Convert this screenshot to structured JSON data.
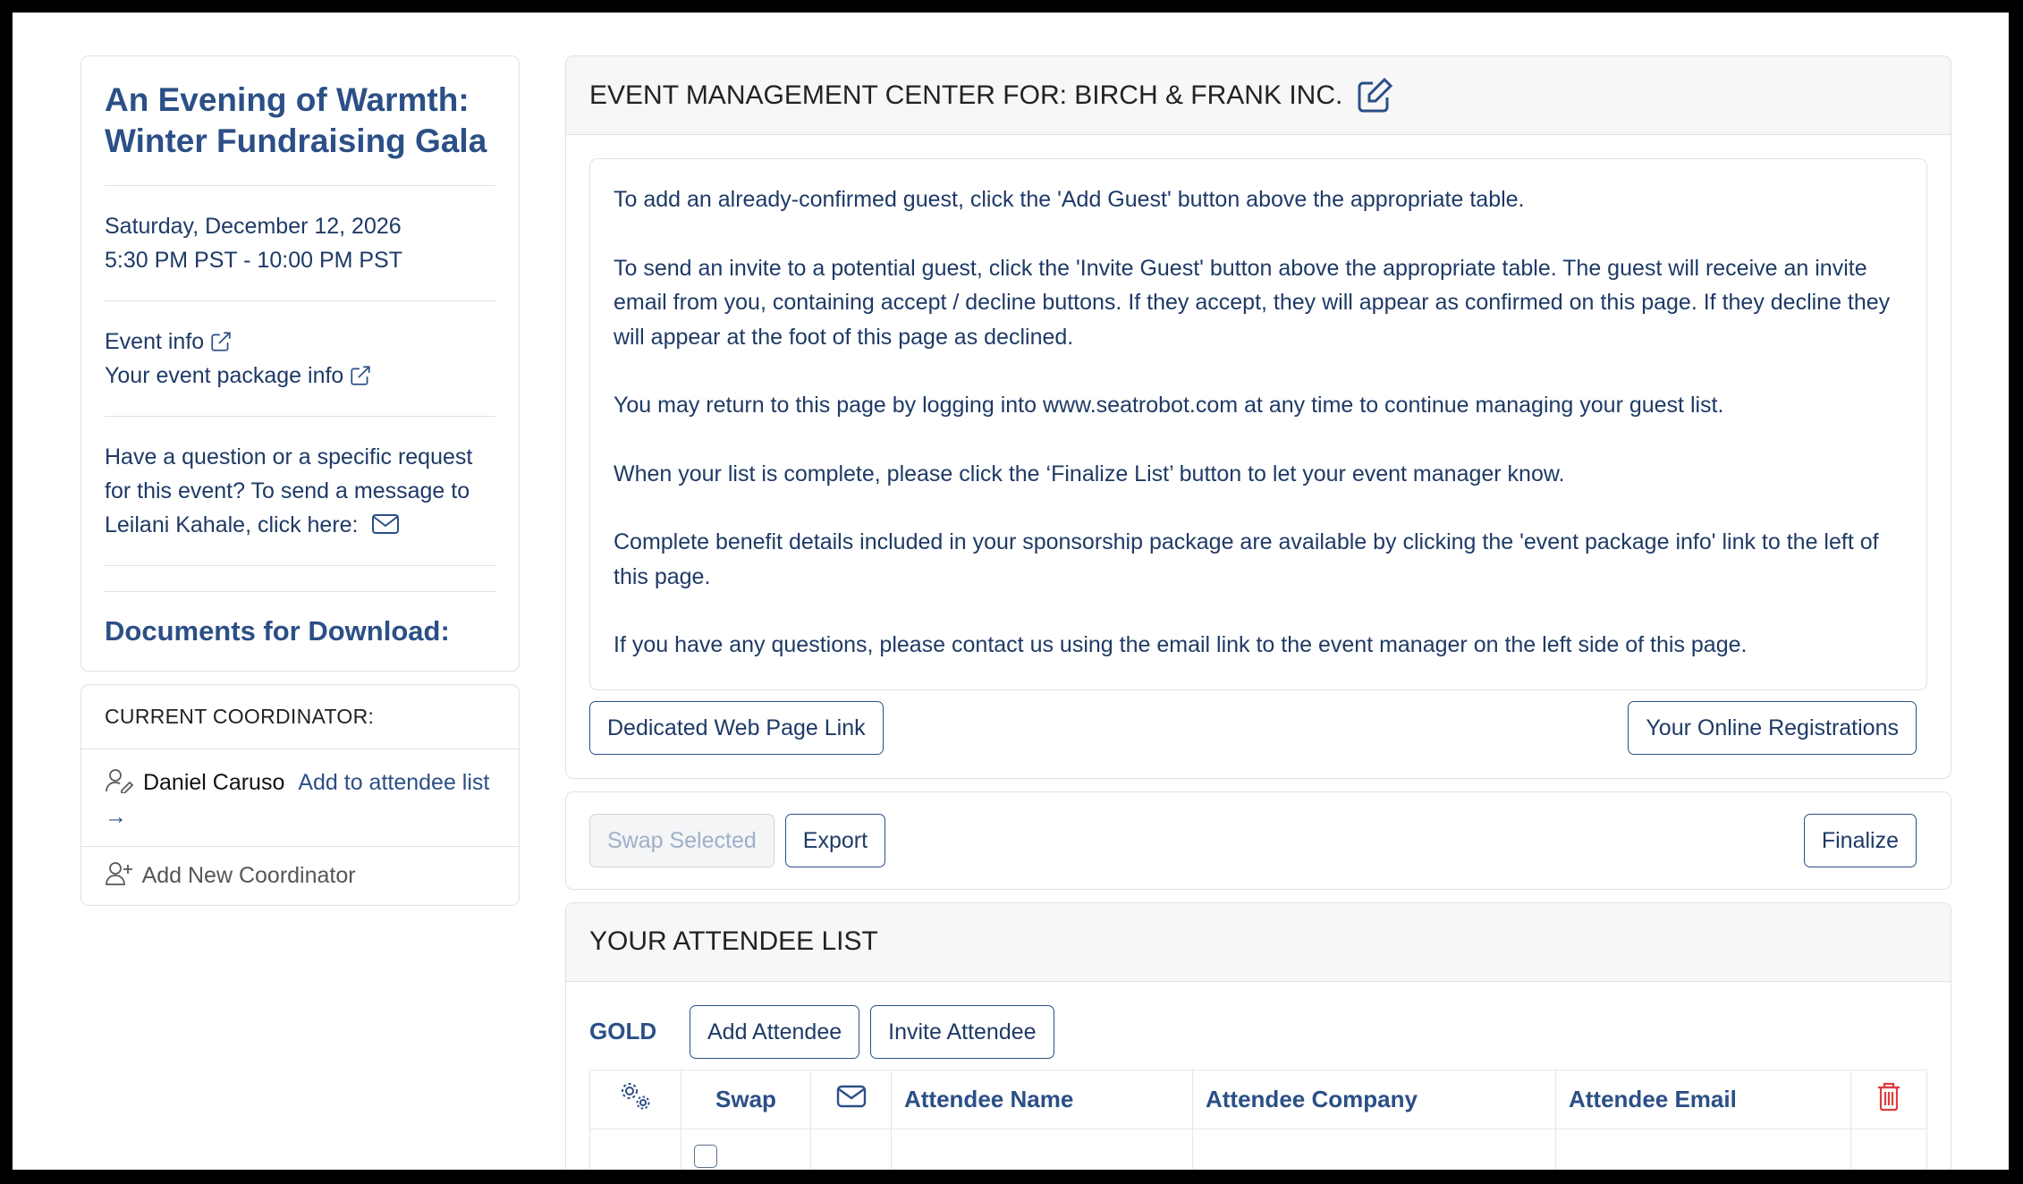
{
  "event": {
    "title": "An Evening of Warmth: Winter Fundraising Gala",
    "date": "Saturday, December 12, 2026",
    "time": "5:30 PM PST - 10:00 PM PST",
    "event_info_label": "Event info",
    "package_info_label": "Your event package info",
    "question_text": "Have a question or a specific request for this event? To send a message to Leilani Kahale, click here:",
    "docs_title": "Documents for Download:"
  },
  "coordinator": {
    "heading": "CURRENT COORDINATOR:",
    "name": "Daniel Caruso",
    "add_link_label": "Add to attendee list →",
    "add_new_label": "Add New Coordinator"
  },
  "main": {
    "header_title": "EVENT MANAGEMENT CENTER FOR: BIRCH & FRANK INC.",
    "instructions": [
      "To add an already-confirmed guest, click the 'Add Guest' button above the appropriate table.",
      "To send an invite to a potential guest, click the 'Invite Guest' button above the appropriate table. The guest will receive an invite email from you, containing accept / decline buttons. If they accept, they will appear as confirmed on this page. If they decline they will appear at the foot of this page as declined.",
      "You may return to this page by logging into www.seatrobot.com at any time to continue managing your guest list.",
      "When your list is complete, please click the ‘Finalize List’ button to let your event manager know.",
      "Complete benefit details included in your sponsorship package are available by clicking the 'event package info' link to the left of this page.",
      "If you have any questions, please contact us using the email link to the event manager on the left side of this page."
    ],
    "web_link_button": "Dedicated Web Page Link",
    "online_reg_button": "Your Online Registrations",
    "swap_selected_button": "Swap Selected",
    "export_button": "Export",
    "finalize_button": "Finalize"
  },
  "attendees": {
    "heading": "YOUR ATTENDEE LIST",
    "tier": "GOLD",
    "add_button": "Add Attendee",
    "invite_button": "Invite Attendee",
    "columns": {
      "swap": "Swap",
      "name": "Attendee Name",
      "company": "Attendee Company",
      "email": "Attendee Email"
    }
  },
  "colors": {
    "accent": "#2b4f86",
    "text": "#1e3a66",
    "danger": "#e03b3b"
  }
}
